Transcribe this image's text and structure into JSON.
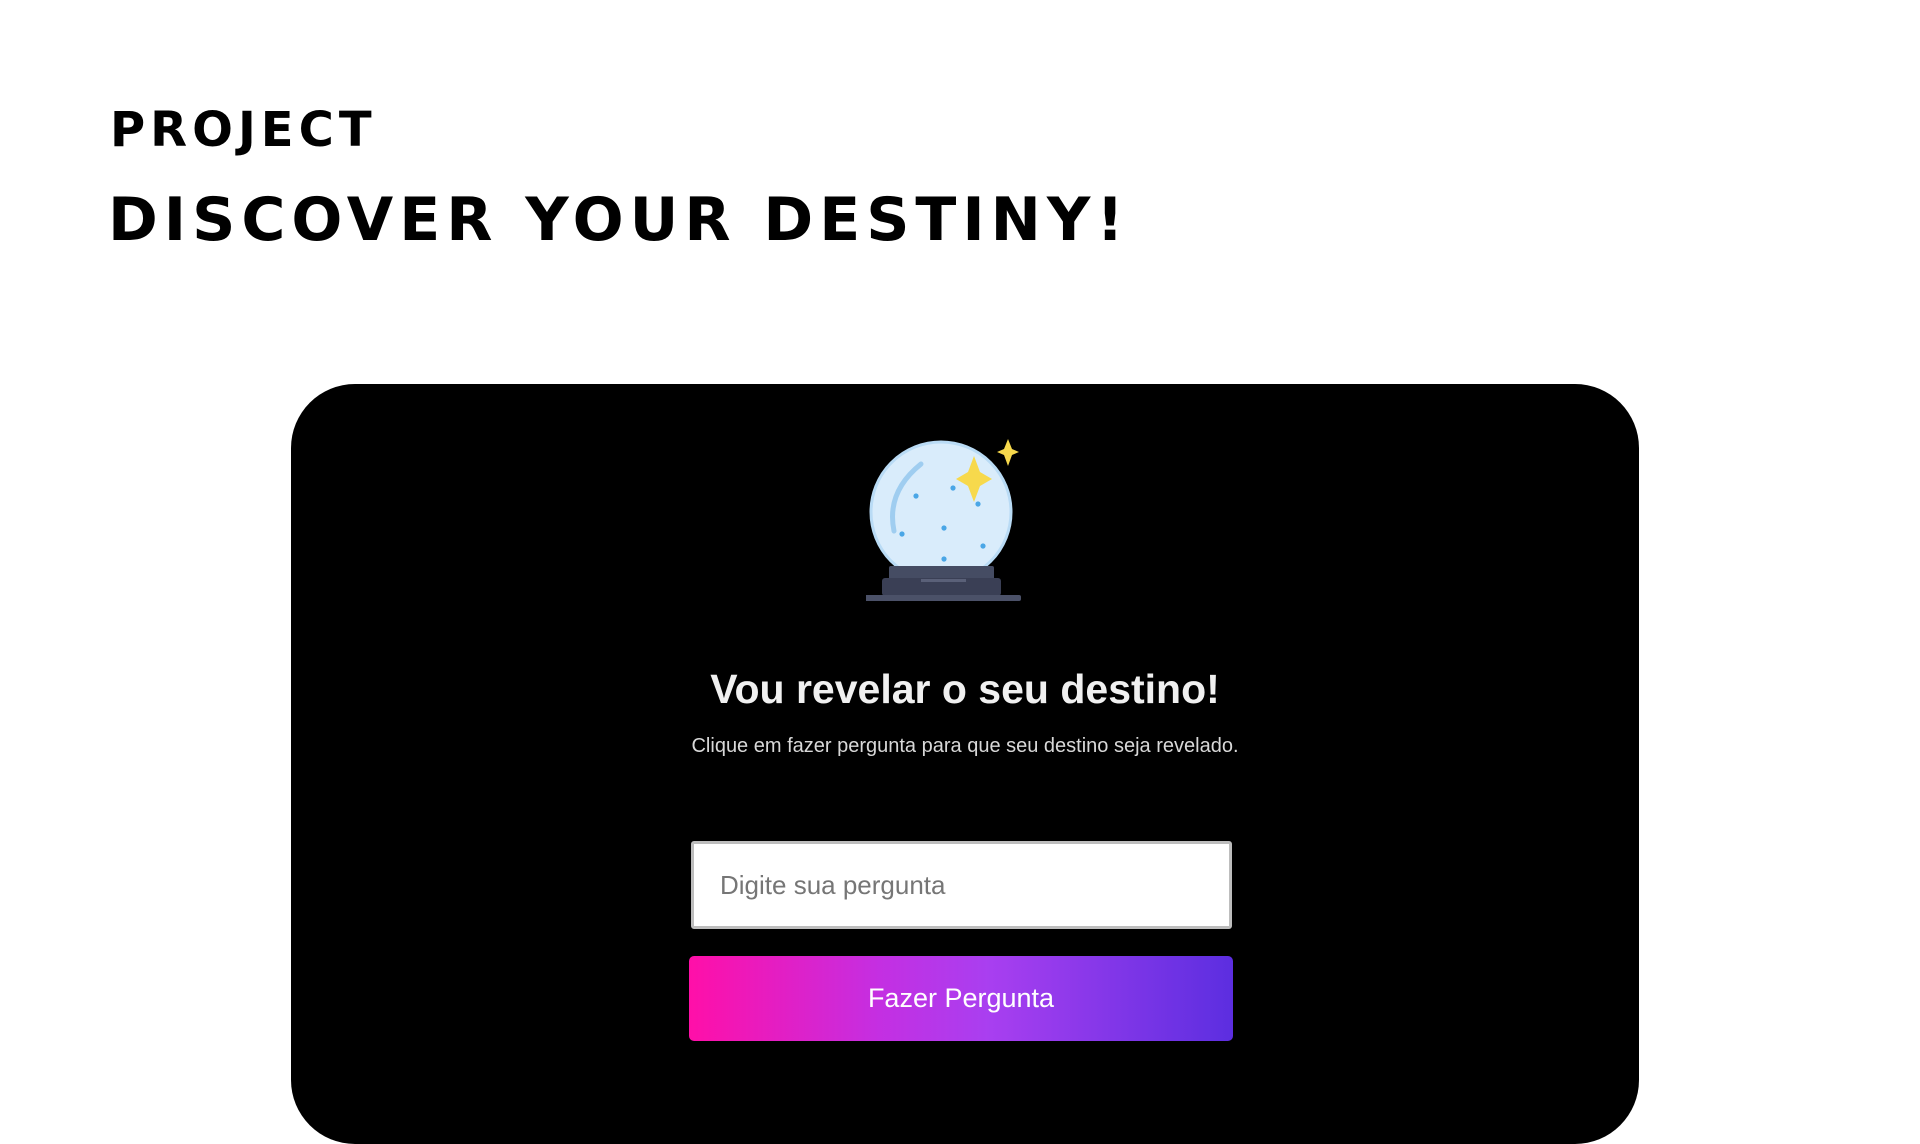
{
  "header": {
    "eyebrow": "PROJECT",
    "headline": "DISCOVER YOUR DESTINY!"
  },
  "app": {
    "icon": "crystal-ball-icon",
    "title": "Vou revelar o seu destino!",
    "subtitle": "Clique em fazer pergunta para que seu destino seja revelado.",
    "question_input": {
      "value": "",
      "placeholder": "Digite sua pergunta"
    },
    "ask_button_label": "Fazer Pergunta"
  },
  "colors": {
    "panel_background": "#000000",
    "button_gradient_start": "#ff0fa8",
    "button_gradient_end": "#5c2ee0",
    "sparkle": "#f7d94c"
  }
}
